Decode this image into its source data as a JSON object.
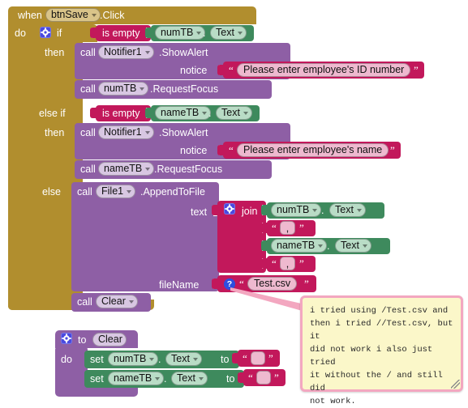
{
  "editor": {
    "name": "MIT App Inventor Blocks Editor",
    "background": "#ffffff"
  },
  "colors": {
    "event_gold": "#B18E2E",
    "control_gold": "#B18E2E",
    "call_purple": "#8E5FA5",
    "text_crimson": "#C2185B",
    "component_green": "#3E8A5D",
    "comment_yellow": "#FBF7C9",
    "comment_border_pink": "#F3A7C0",
    "mutator_blue": "#4A4AE0"
  },
  "event_block": {
    "when_label": "when",
    "component": "btnSave",
    "event": ".Click",
    "do_label": "do"
  },
  "if_block": {
    "gear_icon": "gear-icon",
    "if_label": "if",
    "then_label": "then",
    "else_if_label": "else if",
    "then2_label": "then",
    "else_label": "else"
  },
  "condition_1": {
    "operator": "is empty",
    "component": "numTB",
    "dot": ".",
    "property": "Text"
  },
  "condition_2": {
    "operator": "is empty",
    "component": "nameTB",
    "dot": ".",
    "property": "Text"
  },
  "branch_1": {
    "call_label": "call",
    "component": "Notifier1",
    "method": ".ShowAlert",
    "arg_label": "notice",
    "arg_value": "Please enter employee's ID number",
    "focus_call_label": "call",
    "focus_component": "numTB",
    "focus_method": ".RequestFocus"
  },
  "branch_2": {
    "call_label": "call",
    "component": "Notifier1",
    "method": ".ShowAlert",
    "arg_label": "notice",
    "arg_value": "Please enter employee's name",
    "focus_call_label": "call",
    "focus_component": "nameTB",
    "focus_method": ".RequestFocus"
  },
  "branch_else": {
    "call_label": "call",
    "component": "File1",
    "method": ".AppendToFile",
    "text_arg_label": "text",
    "filename_arg_label": "fileName",
    "filename_value": "Test.csv",
    "filename_help_icon": "question-mark-icon",
    "join": {
      "gear_icon": "gear-icon",
      "label": "join",
      "items": [
        {
          "kind": "getter",
          "component": "numTB",
          "dot": ".",
          "property": "Text"
        },
        {
          "kind": "string",
          "value": ","
        },
        {
          "kind": "getter",
          "component": "nameTB",
          "dot": ".",
          "property": "Text"
        },
        {
          "kind": "string",
          "value": ","
        }
      ]
    },
    "clear_call_label": "call",
    "clear_procedure": "Clear"
  },
  "comment": {
    "text": "i tried using /Test.csv and\nthen i tried //Test.csv, but it\ndid not work i also just tried\nit without the / and still did\nnot work.",
    "resize_handle": "resize-handle-icon"
  },
  "procedure_block": {
    "gear_icon": "gear-icon",
    "to_label": "to",
    "name": "Clear",
    "do_label": "do",
    "statements": [
      {
        "set_label": "set",
        "component": "numTB",
        "dot": ".",
        "property": "Text",
        "to_label": "to",
        "value": ""
      },
      {
        "set_label": "set",
        "component": "nameTB",
        "dot": ".",
        "property": "Text",
        "to_label": "to",
        "value": ""
      }
    ]
  }
}
